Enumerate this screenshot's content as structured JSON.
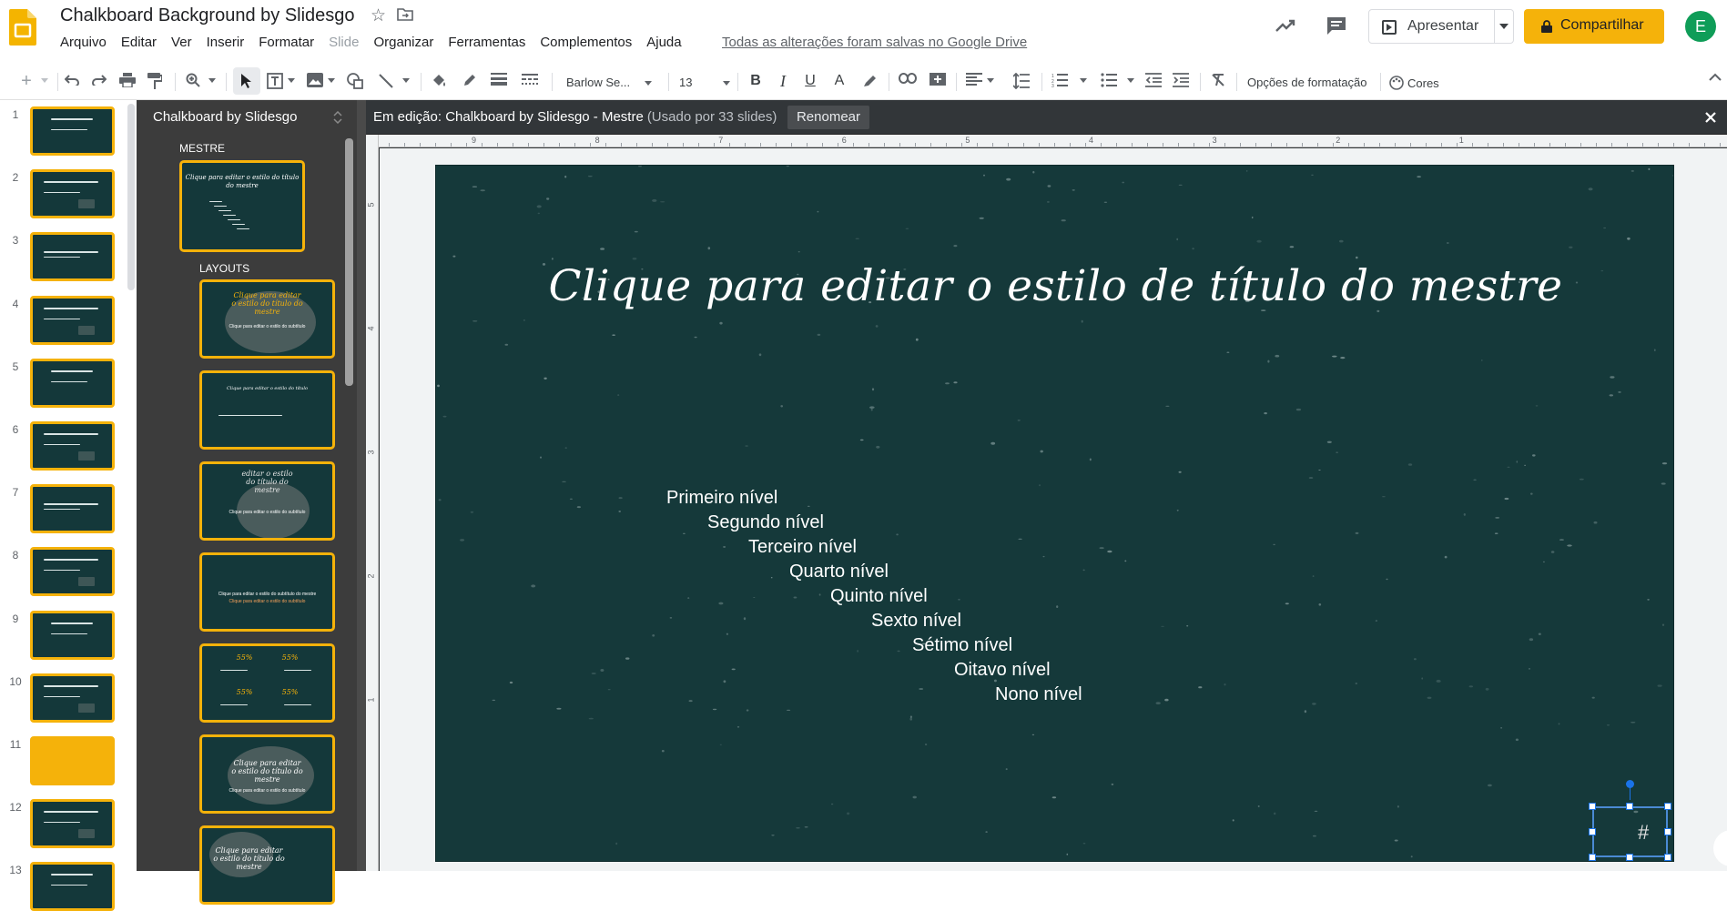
{
  "app": {
    "title": "Chalkboard Background by Slidesgo",
    "save_status": "Todas as alterações foram salvas no Google Drive",
    "avatar_letter": "E"
  },
  "menu": [
    "Arquivo",
    "Editar",
    "Ver",
    "Inserir",
    "Formatar",
    "Slide",
    "Organizar",
    "Ferramentas",
    "Complementos",
    "Ajuda"
  ],
  "actions": {
    "present_label": "Apresentar",
    "share_label": "Compartilhar"
  },
  "toolbar": {
    "font_name": "Barlow Se...",
    "font_size": "13",
    "format_options": "Opções de formatação",
    "colors": "Cores"
  },
  "filmstrip": {
    "slides": [
      {
        "number": "1"
      },
      {
        "number": "2"
      },
      {
        "number": "3"
      },
      {
        "number": "4"
      },
      {
        "number": "5"
      },
      {
        "number": "6"
      },
      {
        "number": "7"
      },
      {
        "number": "8"
      },
      {
        "number": "9"
      },
      {
        "number": "10"
      },
      {
        "number": "11"
      },
      {
        "number": "12"
      },
      {
        "number": "13"
      }
    ]
  },
  "master_panel": {
    "title": "Chalkboard by Slidesgo",
    "master_label": "MESTRE",
    "layouts_label": "LAYOUTS"
  },
  "editor": {
    "editing_label": "Em edição: Chalkboard by Slidesgo - Mestre",
    "usage": "(Usado por 33 slides)",
    "rename": "Renomear"
  },
  "ruler": {
    "horizontal": [
      "9",
      "8",
      "7",
      "6",
      "5",
      "4",
      "3",
      "2",
      "1"
    ],
    "vertical": [
      "5",
      "4",
      "3",
      "2",
      "1"
    ]
  },
  "slide": {
    "title": "Clique para editar o estilo de título do mestre",
    "levels": [
      "Primeiro nível",
      "Segundo nível",
      "Terceiro nível",
      "Quarto nível",
      "Quinto nível",
      "Sexto nível",
      "Sétimo nível",
      "Oitavo nível",
      "Nono nível"
    ],
    "page_number": "#"
  },
  "colors": {
    "accent_yellow": "#f5b20a",
    "slide_bg": "#15393a",
    "selection_blue": "#1a73e8"
  }
}
